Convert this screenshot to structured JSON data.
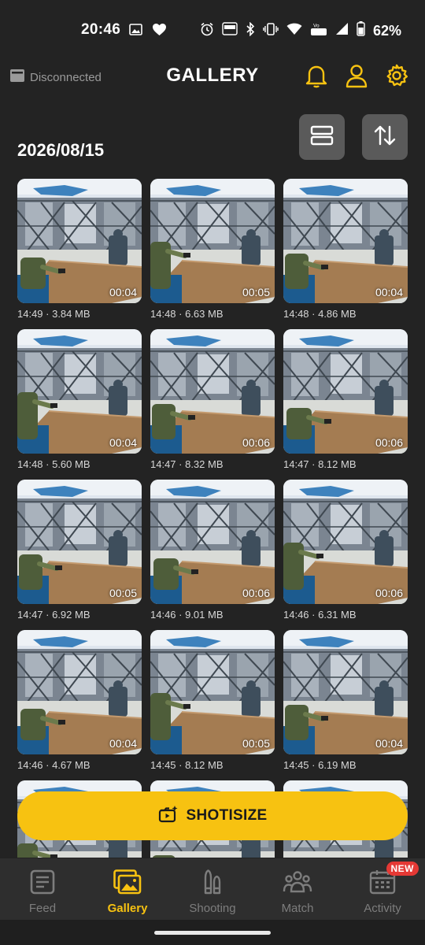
{
  "status_bar": {
    "time": "20:46",
    "battery": "62%",
    "network": "LTE",
    "left_icons": [
      "image-icon",
      "heart-icon"
    ],
    "right_icons": [
      "alarm-icon",
      "auto-icon",
      "bluetooth-icon",
      "vibrate-icon",
      "wifi-icon",
      "volte-icon",
      "signal-icon",
      "battery-icon"
    ]
  },
  "header": {
    "connection_status": "Disconnected",
    "title": "GALLERY",
    "icons": [
      "bell-icon",
      "user-icon",
      "gear-icon"
    ],
    "accent": "#f7c211"
  },
  "toolbar": {
    "icons": [
      "view-toggle-icon",
      "sort-icon"
    ]
  },
  "gallery": {
    "date": "2026/08/15",
    "videos": [
      {
        "duration": "00:04",
        "meta": "14:49 · 3.84 MB"
      },
      {
        "duration": "00:05",
        "meta": "14:48 · 6.63 MB"
      },
      {
        "duration": "00:04",
        "meta": "14:48 · 4.86 MB"
      },
      {
        "duration": "00:04",
        "meta": "14:48 · 5.60 MB"
      },
      {
        "duration": "00:06",
        "meta": "14:47 · 8.32 MB"
      },
      {
        "duration": "00:06",
        "meta": "14:47 · 8.12 MB"
      },
      {
        "duration": "00:05",
        "meta": "14:47 · 6.92 MB"
      },
      {
        "duration": "00:06",
        "meta": "14:46 · 9.01 MB"
      },
      {
        "duration": "00:06",
        "meta": "14:46 · 6.31 MB"
      },
      {
        "duration": "00:04",
        "meta": "14:46 · 4.67 MB"
      },
      {
        "duration": "00:05",
        "meta": "14:45 · 8.12 MB"
      },
      {
        "duration": "00:04",
        "meta": "14:45 · 6.19 MB"
      },
      {
        "duration": "",
        "meta": ""
      },
      {
        "duration": "",
        "meta": ""
      },
      {
        "duration": "",
        "meta": ""
      }
    ]
  },
  "action_button": {
    "label": "SHOTISIZE",
    "icon": "camera-sparkle-icon",
    "color": "#f7c211"
  },
  "bottom_nav": {
    "items": [
      {
        "label": "Feed",
        "icon": "feed-icon",
        "active": false
      },
      {
        "label": "Gallery",
        "icon": "gallery-icon",
        "active": true
      },
      {
        "label": "Shooting",
        "icon": "bullets-icon",
        "active": false
      },
      {
        "label": "Match",
        "icon": "group-icon",
        "active": false
      },
      {
        "label": "Activity",
        "icon": "calendar-icon",
        "active": false,
        "badge": "NEW"
      }
    ]
  }
}
